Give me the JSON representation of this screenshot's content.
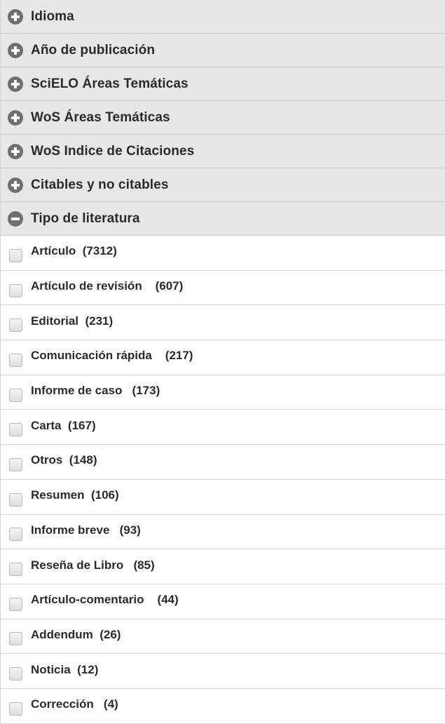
{
  "facets": [
    {
      "title": "Idioma",
      "state": "collapsed"
    },
    {
      "title": "Año de publicación",
      "state": "collapsed"
    },
    {
      "title": "SciELO Áreas Temáticas",
      "state": "collapsed"
    },
    {
      "title": "WoS Áreas Temáticas",
      "state": "collapsed"
    },
    {
      "title": "WoS Indice de Citaciones",
      "state": "collapsed"
    },
    {
      "title": "Citables y no citables",
      "state": "collapsed"
    },
    {
      "title": "Tipo de literatura",
      "state": "expanded"
    }
  ],
  "tipo_de_literatura": {
    "options": [
      {
        "label": "Artículo",
        "count": "(7312)",
        "gap": "  "
      },
      {
        "label": "Artículo de revisión",
        "count": "(607)",
        "gap": "    "
      },
      {
        "label": "Editorial",
        "count": "(231)",
        "gap": "  "
      },
      {
        "label": "Comunicación rápida",
        "count": "(217)",
        "gap": "    "
      },
      {
        "label": "Informe de caso",
        "count": "(173)",
        "gap": "   "
      },
      {
        "label": "Carta",
        "count": "(167)",
        "gap": "  "
      },
      {
        "label": "Otros",
        "count": "(148)",
        "gap": "  "
      },
      {
        "label": "Resumen",
        "count": "(106)",
        "gap": "  "
      },
      {
        "label": "Informe breve",
        "count": "(93)",
        "gap": "   "
      },
      {
        "label": "Reseña de Libro",
        "count": "(85)",
        "gap": "   "
      },
      {
        "label": "Artículo-comentario",
        "count": "(44)",
        "gap": "    "
      },
      {
        "label": "Addendum",
        "count": "(26)",
        "gap": "  "
      },
      {
        "label": "Noticia",
        "count": "(12)",
        "gap": "  "
      },
      {
        "label": "Corrección",
        "count": "(4)",
        "gap": "   "
      }
    ]
  },
  "colors": {
    "header_bg": "#e7e7e7",
    "icon": "#6f6f6f",
    "text": "#2b2b2b"
  },
  "icons": {
    "collapsed": "plus-circle-icon",
    "expanded": "minus-circle-icon"
  }
}
